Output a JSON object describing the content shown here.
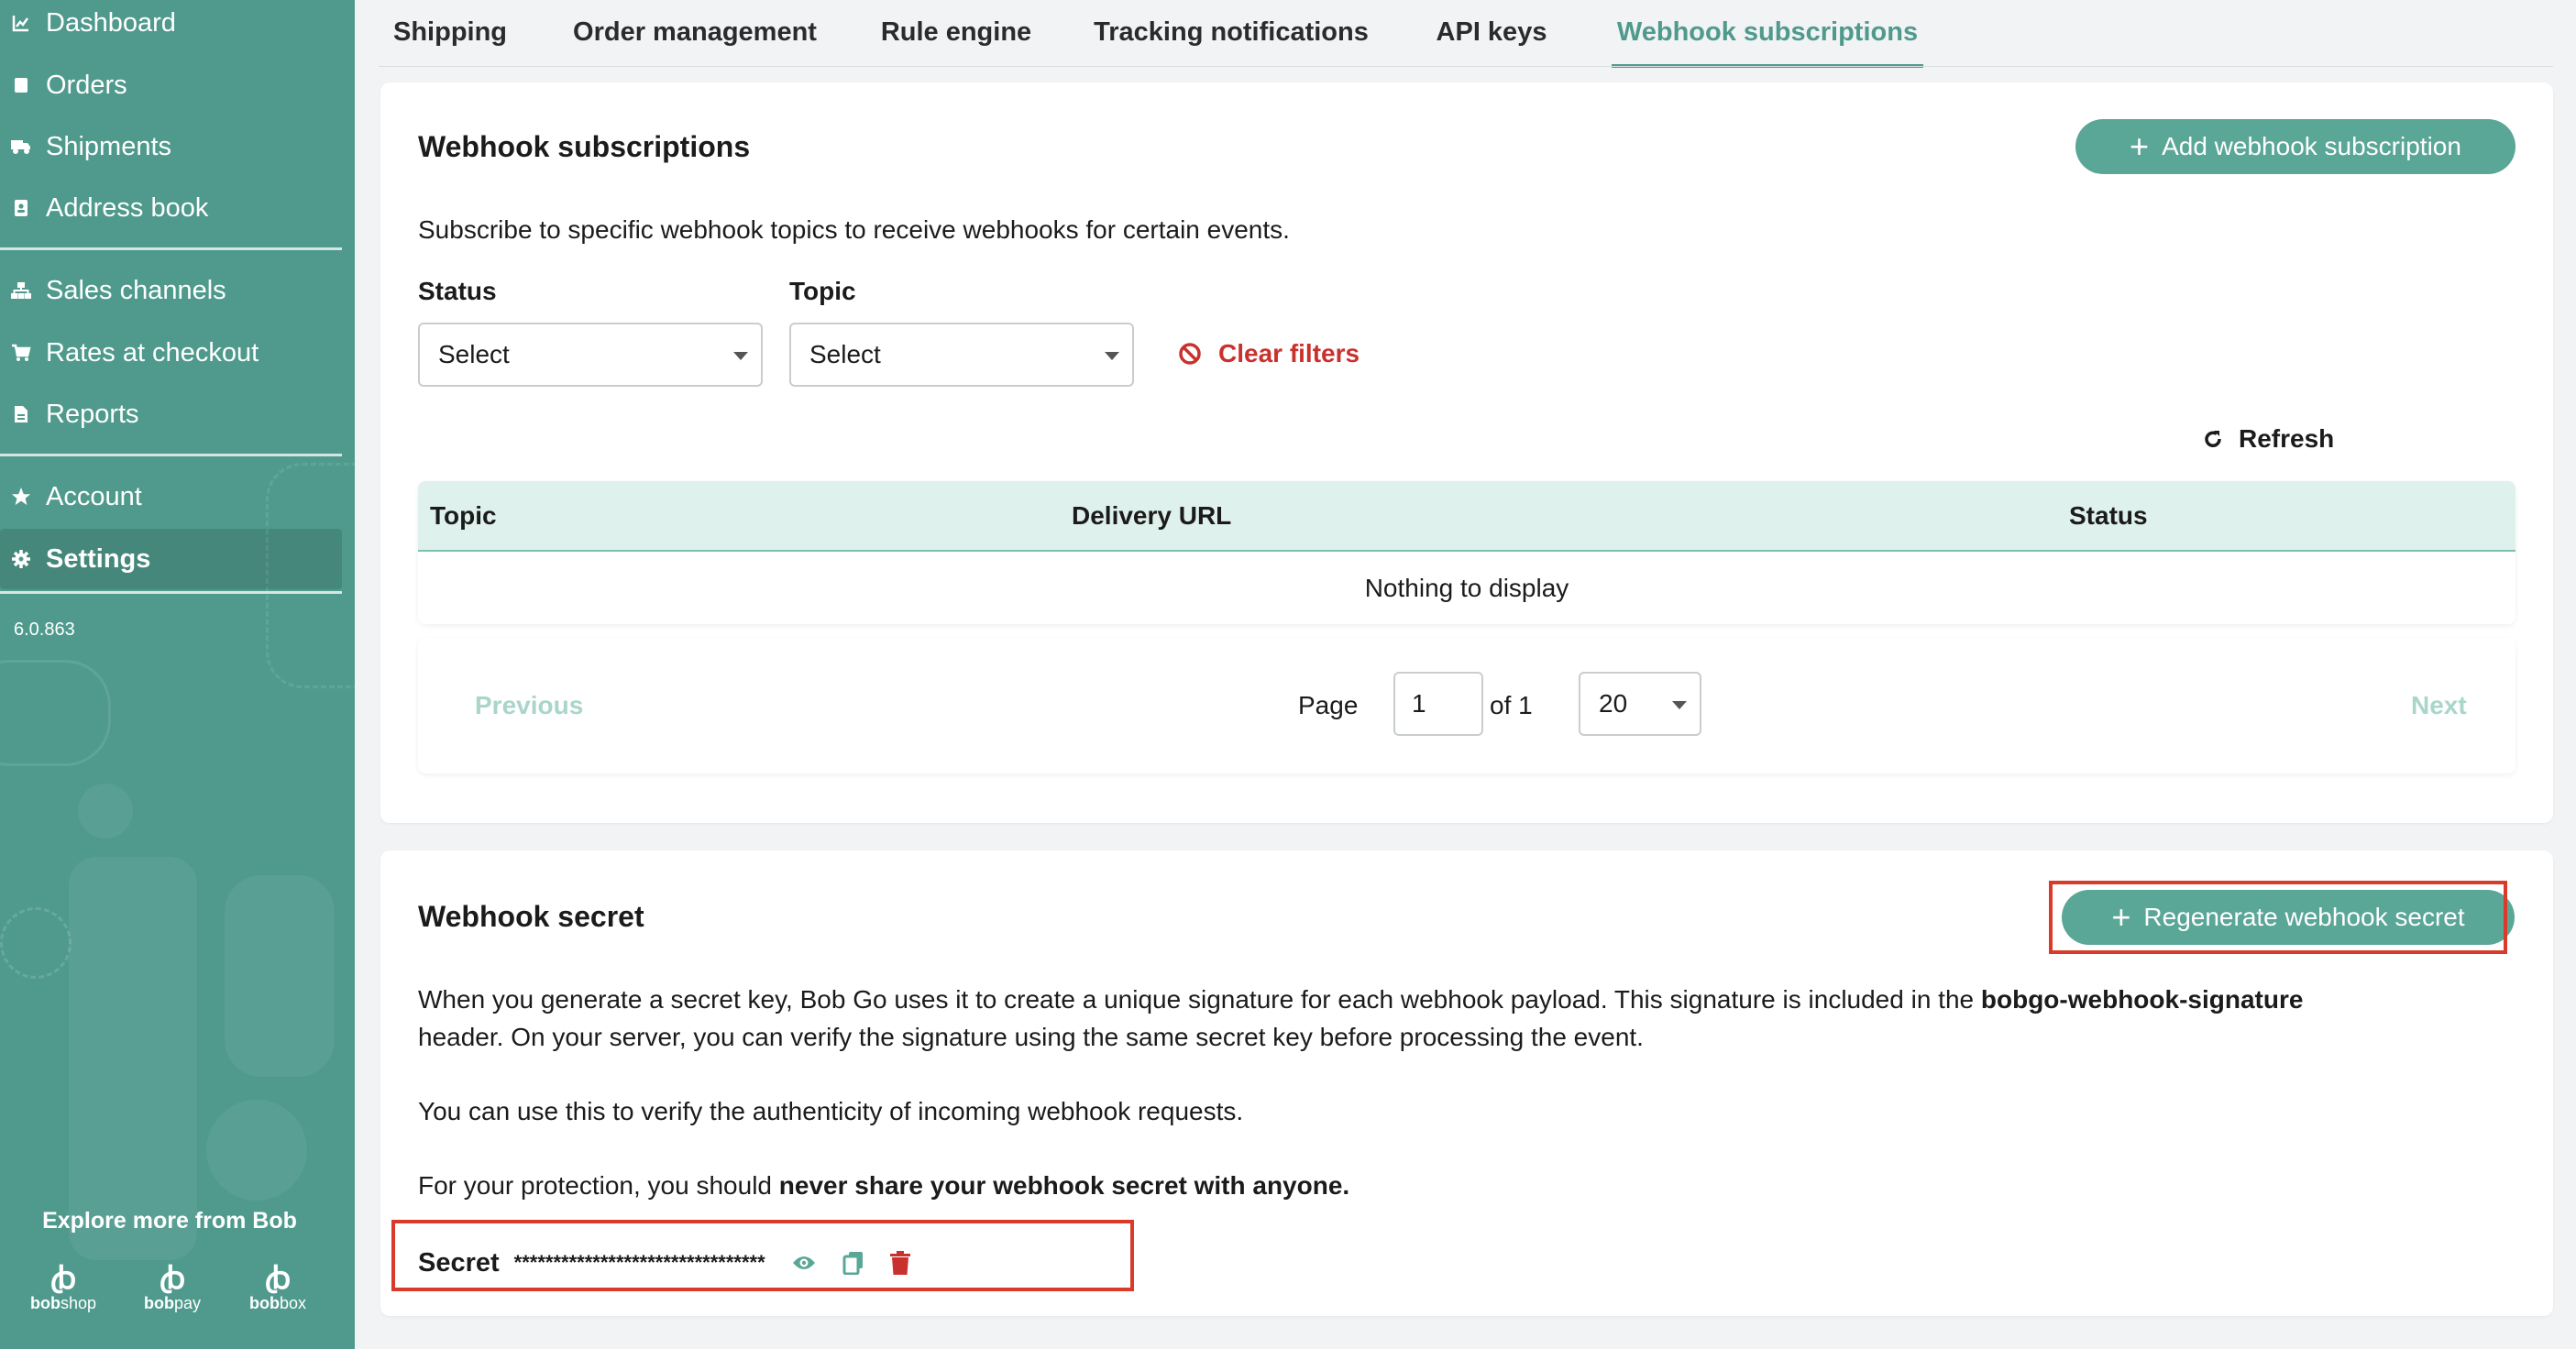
{
  "sidebar": {
    "items": [
      {
        "label": "Dashboard",
        "icon": "chart-line-icon"
      },
      {
        "label": "Orders",
        "icon": "box-icon"
      },
      {
        "label": "Shipments",
        "icon": "truck-icon"
      },
      {
        "label": "Address book",
        "icon": "address-book-icon"
      },
      {
        "label": "Sales channels",
        "icon": "sitemap-icon"
      },
      {
        "label": "Rates at checkout",
        "icon": "cart-icon"
      },
      {
        "label": "Reports",
        "icon": "file-icon"
      },
      {
        "label": "Account",
        "icon": "star-icon"
      },
      {
        "label": "Settings",
        "icon": "gear-icon",
        "active": true
      }
    ],
    "version": "6.0.863",
    "explore_title": "Explore more from Bob",
    "brands": [
      {
        "prefix": "bob",
        "suffix": "shop"
      },
      {
        "prefix": "bob",
        "suffix": "pay"
      },
      {
        "prefix": "bob",
        "suffix": "box"
      }
    ],
    "brand_mark": "ꞗ"
  },
  "tabs": [
    {
      "label": "Shipping"
    },
    {
      "label": "Order management"
    },
    {
      "label": "Rule engine"
    },
    {
      "label": "Tracking notifications"
    },
    {
      "label": "API keys"
    },
    {
      "label": "Webhook subscriptions",
      "active": true
    }
  ],
  "subscriptions": {
    "title": "Webhook subscriptions",
    "add_button": "Add webhook subscription",
    "description": "Subscribe to specific webhook topics to receive webhooks for certain events.",
    "filters": {
      "status_label": "Status",
      "status_value": "Select",
      "topic_label": "Topic",
      "topic_value": "Select",
      "clear_label": "Clear filters"
    },
    "refresh_label": "Refresh",
    "table": {
      "columns": [
        "Topic",
        "Delivery URL",
        "Status"
      ],
      "empty_text": "Nothing to display"
    },
    "pagination": {
      "previous": "Previous",
      "page_label": "Page",
      "page_value": "1",
      "of_label": "of 1",
      "page_size": "20",
      "next": "Next"
    }
  },
  "secret": {
    "title": "Webhook secret",
    "regenerate_button": "Regenerate webhook secret",
    "para1_start": "When you generate a secret key, Bob Go uses it to create a unique signature for each webhook payload. This signature is included in the ",
    "para1_bold": "bobgo-webhook-signature",
    "para1_end": "header. On your server, you can verify the signature using the same secret key before processing the event.",
    "para2": "You can use this to verify the authenticity of incoming webhook requests.",
    "para3_start": "For your protection, you should ",
    "para3_bold": "never share your webhook secret with anyone.",
    "secret_label": "Secret",
    "secret_value": "********************************"
  },
  "colors": {
    "brand": "#4f9a8d",
    "button": "#5aa697",
    "danger": "#c9312d",
    "highlight_box": "#d93b2b"
  }
}
